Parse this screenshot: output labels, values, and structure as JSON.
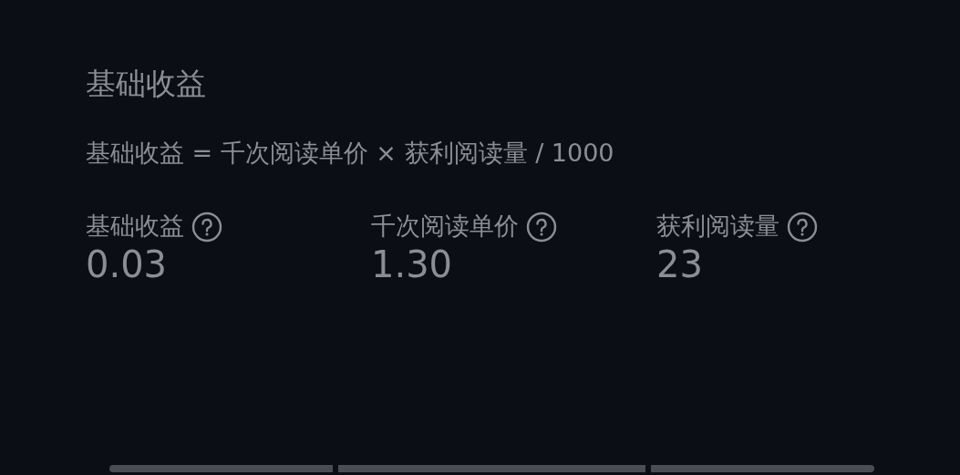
{
  "section": {
    "title": "基础收益",
    "formula": "基础收益 = 千次阅读单价 × 获利阅读量 / 1000"
  },
  "metrics": [
    {
      "label": "基础收益",
      "value": "0.03"
    },
    {
      "label": "千次阅读单价",
      "value": "1.30"
    },
    {
      "label": "获利阅读量",
      "value": "23"
    }
  ]
}
